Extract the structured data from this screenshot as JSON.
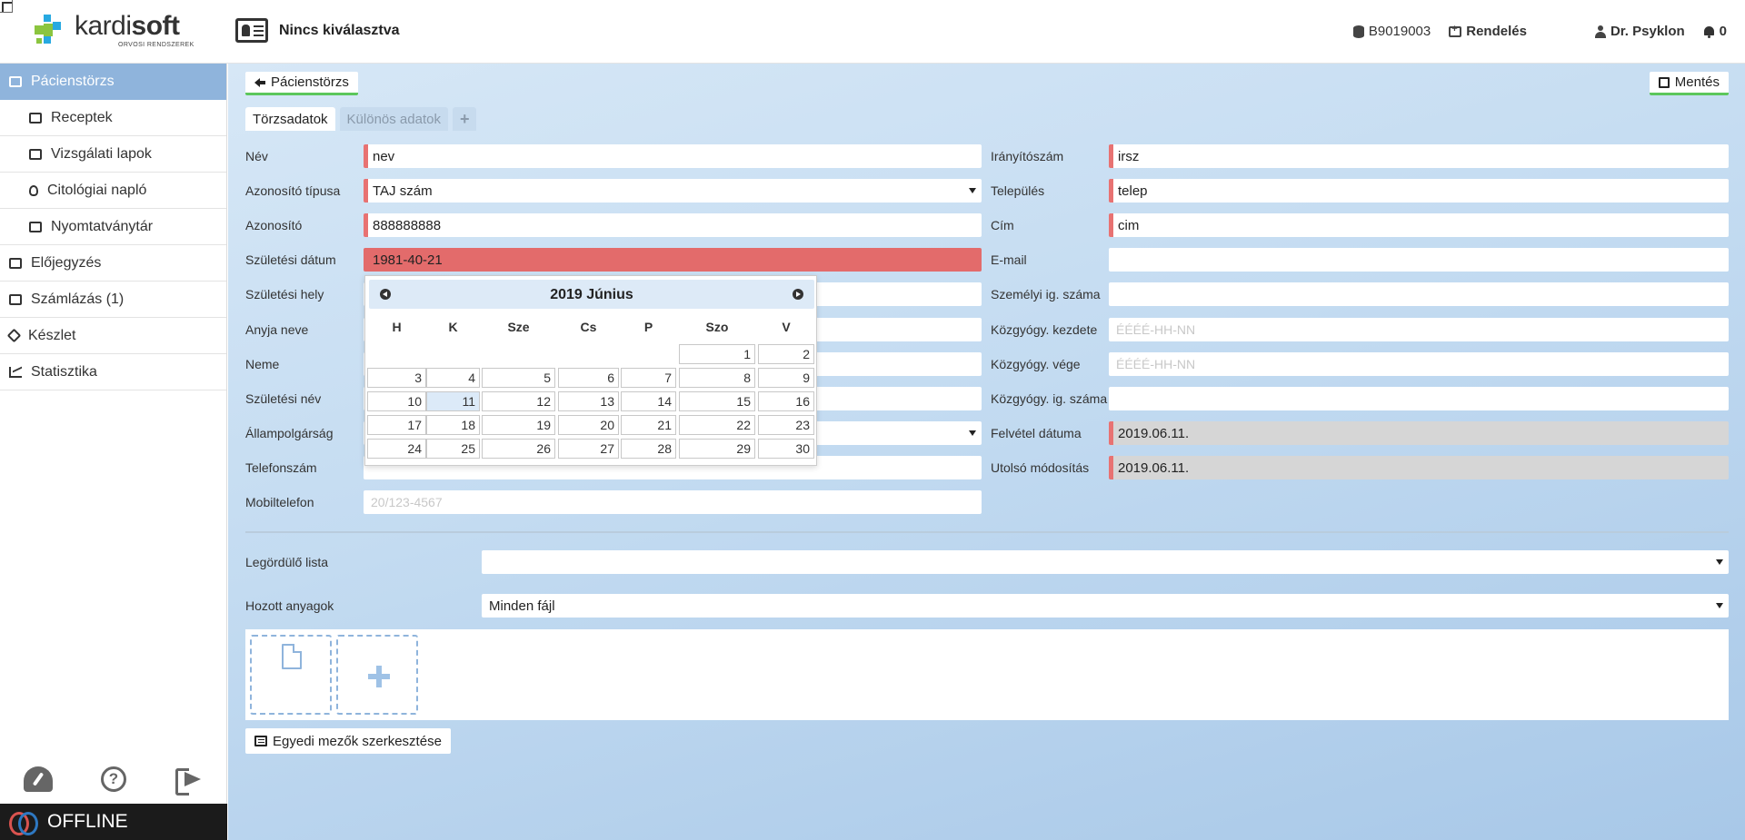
{
  "header": {
    "logo_text_light": "kardi",
    "logo_text_bold": "soft",
    "logo_subtitle": "ORVOSI RENDSZEREK",
    "patient_selection": "Nincs kiválasztva",
    "station_code": "B9019003",
    "clinic_label": "Rendelés",
    "user_name": "Dr. Psyklon",
    "notification_count": "0"
  },
  "sidebar": {
    "items": [
      {
        "label": "Pácienstörzs",
        "icon": "id-card-icon",
        "active": true
      },
      {
        "label": "Receptek",
        "icon": "printer-icon"
      },
      {
        "label": "Vizsgálati lapok",
        "icon": "user-card-icon"
      },
      {
        "label": "Citológiai napló",
        "icon": "lightbulb-icon"
      },
      {
        "label": "Nyomtatványtár",
        "icon": "folder-open-icon"
      },
      {
        "label": "Előjegyzés",
        "icon": "calendar-icon"
      },
      {
        "label": "Számlázás (1)",
        "icon": "credit-card-icon"
      },
      {
        "label": "Készlet",
        "icon": "cube-icon"
      },
      {
        "label": "Statisztika",
        "icon": "line-chart-icon"
      }
    ],
    "status": "OFFLINE"
  },
  "toolbar": {
    "back_label": "Pácienstörzs",
    "save_label": "Mentés"
  },
  "tabs": [
    {
      "label": "Törzsadatok",
      "active": true
    },
    {
      "label": "Különös adatok",
      "active": false
    },
    {
      "label": "+",
      "active": false
    }
  ],
  "form_left": {
    "name_label": "Név",
    "name_value": "nev",
    "idtype_label": "Azonosító típusa",
    "idtype_value": "TAJ szám",
    "id_label": "Azonosító",
    "id_value": "888888888",
    "dob_label": "Születési dátum",
    "dob_value": "1981-40-21",
    "pob_label": "Születési hely",
    "mother_label": "Anyja neve",
    "sex_label": "Neme",
    "birthname_label": "Születési név",
    "citizenship_label": "Állampolgárság",
    "phone_label": "Telefonszám",
    "mobile_label": "Mobiltelefon",
    "mobile_placeholder": "20/123-4567"
  },
  "form_right": {
    "zip_label": "Irányítószám",
    "zip_value": "irsz",
    "city_label": "Település",
    "city_value": "telep",
    "address_label": "Cím",
    "address_value": "cim",
    "email_label": "E-mail",
    "personal_id_label": "Személyi ig. száma",
    "pubcare_start_label": "Közgyógy. kezdete",
    "pubcare_start_placeholder": "ÉÉÉÉ-HH-NN",
    "pubcare_end_label": "Közgyógy. vége",
    "pubcare_end_placeholder": "ÉÉÉÉ-HH-NN",
    "pubcare_id_label": "Közgyógy. ig. száma",
    "admission_label": "Felvétel dátuma",
    "admission_value": "2019.06.11.",
    "modified_label": "Utolsó módosítás",
    "modified_value": "2019.06.11."
  },
  "datepicker": {
    "title": "2019 Június",
    "weekdays": [
      "H",
      "K",
      "Sze",
      "Cs",
      "P",
      "Szo",
      "V"
    ],
    "weeks": [
      [
        "",
        "",
        "",
        "",
        "",
        "1",
        "2"
      ],
      [
        "3",
        "4",
        "5",
        "6",
        "7",
        "8",
        "9"
      ],
      [
        "10",
        "11",
        "12",
        "13",
        "14",
        "15",
        "16"
      ],
      [
        "17",
        "18",
        "19",
        "20",
        "21",
        "22",
        "23"
      ],
      [
        "24",
        "25",
        "26",
        "27",
        "28",
        "29",
        "30"
      ]
    ],
    "highlighted_day": "11"
  },
  "bottom": {
    "dropdown_label": "Legördülő lista",
    "dropdown_value": "",
    "materials_label": "Hozott anyagok",
    "materials_value": "Minden fájl",
    "custom_fields_button": "Egyedi mezők szerkesztése"
  },
  "colors": {
    "accent": "#8fb4dc",
    "required_marker": "#e87272",
    "error_field": "#e36b6b",
    "save_underline": "#5cc75c"
  }
}
